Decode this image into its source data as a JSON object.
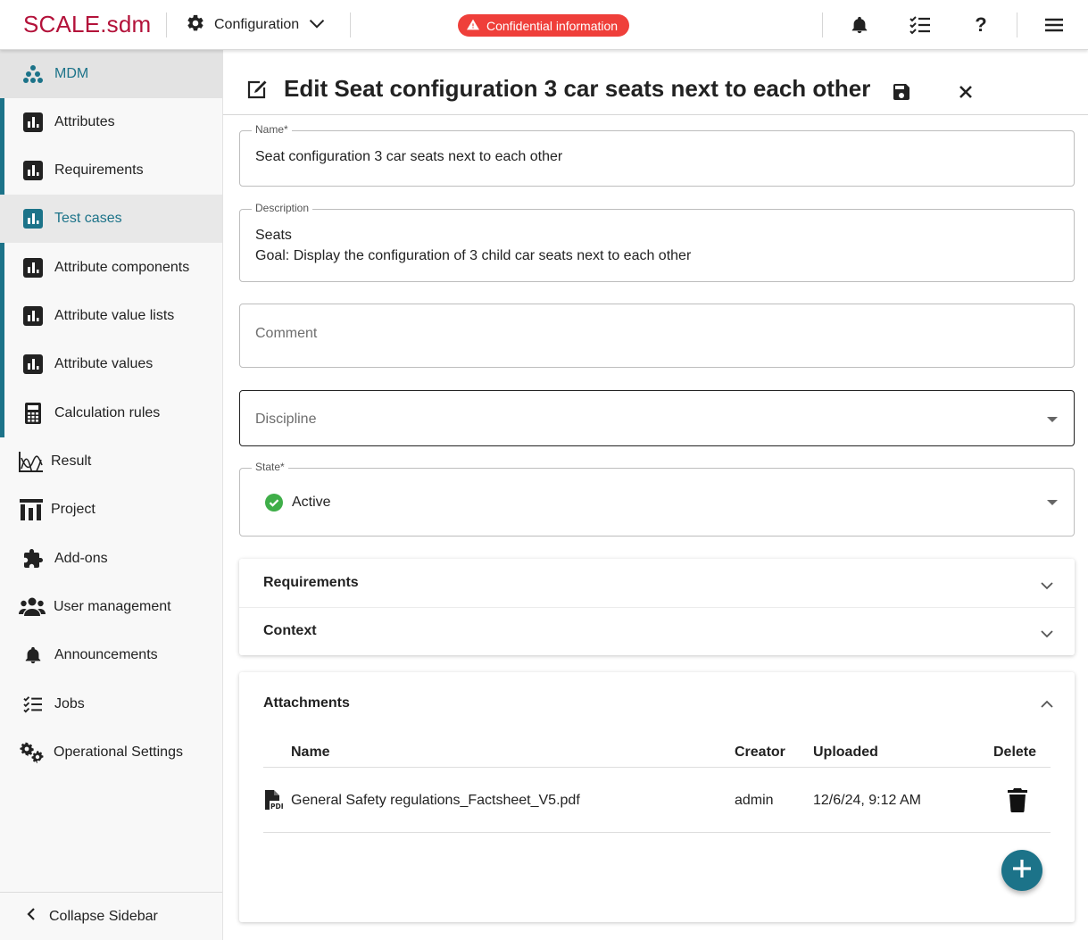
{
  "topbar": {
    "logo": "SCALE.sdm",
    "menu_label": "Configuration",
    "badge_text": "Confidential information",
    "help_label": "?",
    "icons": [
      "settings-gear-icon",
      "chevron-down-icon",
      "warning-icon",
      "bell-icon",
      "checklist-icon",
      "help-icon",
      "hamburger-menu-icon"
    ]
  },
  "sidebar": {
    "items": [
      {
        "label": "MDM",
        "icon": "hierarchy-icon"
      },
      {
        "label": "Attributes",
        "icon": "bar-chart-icon"
      },
      {
        "label": "Requirements",
        "icon": "bar-chart-icon"
      },
      {
        "label": "Test cases",
        "icon": "bar-chart-icon"
      },
      {
        "label": "Attribute components",
        "icon": "bar-chart-icon"
      },
      {
        "label": "Attribute value lists",
        "icon": "bar-chart-icon"
      },
      {
        "label": "Attribute values",
        "icon": "bar-chart-icon"
      },
      {
        "label": "Calculation rules",
        "icon": "calculator-icon"
      },
      {
        "label": "Result",
        "icon": "waveform-icon"
      },
      {
        "label": "Project",
        "icon": "columns-chart-icon"
      },
      {
        "label": "Add-ons",
        "icon": "puzzle-icon"
      },
      {
        "label": "User management",
        "icon": "users-icon"
      },
      {
        "label": "Announcements",
        "icon": "bell-icon"
      },
      {
        "label": "Jobs",
        "icon": "checklist-icon"
      },
      {
        "label": "Operational Settings",
        "icon": "gears-icon"
      }
    ],
    "collapse_label": "Collapse Sidebar"
  },
  "header": {
    "title": "Edit Seat configuration 3 car seats next to each other"
  },
  "form": {
    "name_label": "Name*",
    "name_value": "Seat configuration 3 car seats next to each other",
    "description_label": "Description",
    "description_line1": "Seats",
    "description_line2": "Goal: Display the configuration of 3 child car seats next to each other",
    "comment_placeholder": "Comment",
    "discipline_placeholder": "Discipline",
    "state_label": "State*",
    "state_value": "Active"
  },
  "sections": {
    "requirements": "Requirements",
    "context": "Context",
    "attachments": "Attachments"
  },
  "attachments": {
    "columns": [
      "Name",
      "Creator",
      "Uploaded",
      "Delete"
    ],
    "rows": [
      {
        "name": "General Safety regulations_Factsheet_V5.pdf",
        "creator": "admin",
        "uploaded": "12/6/24, 9:12 AM"
      }
    ]
  },
  "colors": {
    "brand": "#b3123a",
    "accent": "#1c7389",
    "badge": "#ef3f3a",
    "active_status": "#3fae49"
  }
}
